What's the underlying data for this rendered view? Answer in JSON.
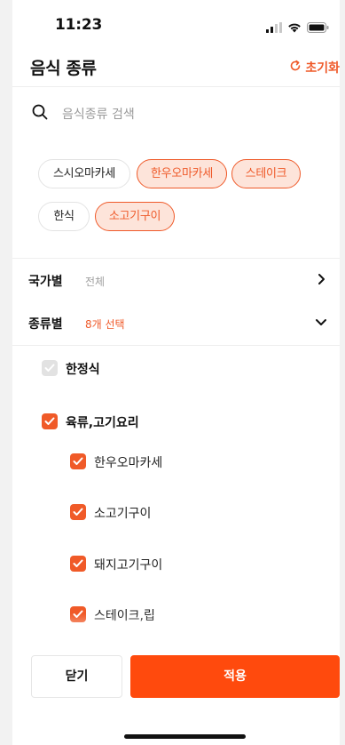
{
  "status": {
    "time": "11:23"
  },
  "header": {
    "title": "음식 종류",
    "reset_label": "초기화"
  },
  "search": {
    "placeholder": "음식종류 검색"
  },
  "chips": [
    {
      "label": "스시오마카세",
      "selected": false
    },
    {
      "label": "한우오마카세",
      "selected": true
    },
    {
      "label": "스테이크",
      "selected": true
    },
    {
      "label": "한식",
      "selected": false
    },
    {
      "label": "소고기구이",
      "selected": true
    }
  ],
  "filters": {
    "country": {
      "label": "국가별",
      "value": "전체"
    },
    "type": {
      "label": "종류별",
      "value": "8개 선택"
    }
  },
  "categories": [
    {
      "label": "한정식",
      "checked": false,
      "disabled": true
    },
    {
      "label": "육류,고기요리",
      "checked": true,
      "children": [
        {
          "label": "한우오마카세",
          "checked": true
        },
        {
          "label": "소고기구이",
          "checked": true
        },
        {
          "label": "돼지고기구이",
          "checked": true
        },
        {
          "label": "스테이크,립",
          "checked": true
        }
      ]
    }
  ],
  "footer": {
    "close_label": "닫기",
    "apply_label": "적용"
  },
  "colors": {
    "accent": "#f05a28",
    "apply_bg": "#ff4a0d",
    "chip_selected_bg": "#fde4da"
  },
  "icons": [
    "signal-icon",
    "wifi-icon",
    "battery-icon",
    "refresh-icon",
    "search-icon",
    "chevron-right-icon",
    "chevron-down-icon",
    "check-icon"
  ]
}
